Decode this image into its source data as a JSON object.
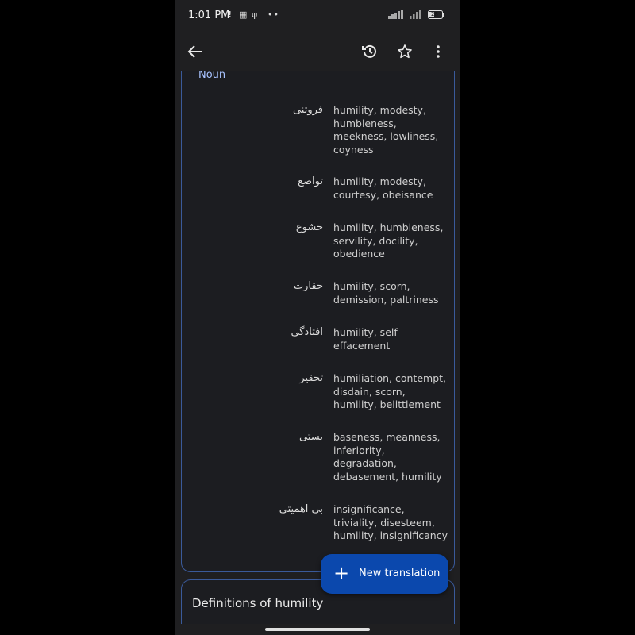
{
  "status_bar": {
    "time": "1:01 PM",
    "icons": [
      "alert-icon",
      "qr-icon",
      "usb-icon",
      "more-dots-icon"
    ],
    "right_icons": [
      "wifi-icon",
      "signal-icon",
      "battery-icon"
    ],
    "battery": "28"
  },
  "app_bar": {
    "back_icon": "arrow-left-icon",
    "history_icon": "history-icon",
    "star_icon": "star-icon",
    "menu_icon": "more-vert-icon"
  },
  "translations": {
    "part_of_speech": "Noun",
    "entries": [
      {
        "source": "فروتنی",
        "targets": "humility, modesty, humbleness, meekness, lowliness, coyness"
      },
      {
        "source": "تواضع",
        "targets": "humility, modesty, courtesy, obeisance"
      },
      {
        "source": "خشوع",
        "targets": "humility, humbleness, servility, docility, obedience"
      },
      {
        "source": "حقارت",
        "targets": "humility, scorn, demission, paltriness"
      },
      {
        "source": "افتادگی",
        "targets": "humility, self-effacement"
      },
      {
        "source": "تحقیر",
        "targets": "humiliation, contempt, disdain, scorn, humility, belittlement"
      },
      {
        "source": "بستی",
        "targets": "baseness, meanness, inferiority, degradation, debasement, humility"
      },
      {
        "source": "بی اهمیتی",
        "targets": "insignificance, triviality, disesteem, humility, insignificancy"
      }
    ]
  },
  "definitions": {
    "title": "Definitions of humility"
  },
  "fab": {
    "label": "New translation",
    "icon": "plus-icon"
  },
  "colors": {
    "accent": "#a8c3ff",
    "fab": "#0b48ad",
    "card_border": "#3a5a9a",
    "background": "#1f1f21"
  }
}
